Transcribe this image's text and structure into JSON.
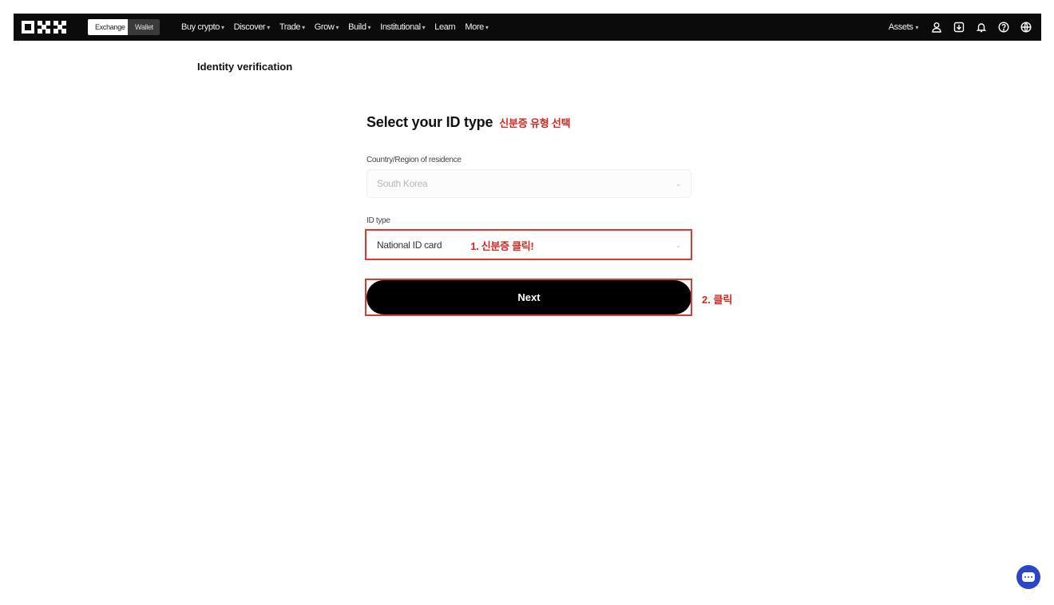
{
  "nav": {
    "mode_tabs": [
      {
        "label": "Exchange",
        "active": true
      },
      {
        "label": "Wallet",
        "active": false
      }
    ],
    "items": [
      {
        "label": "Buy crypto",
        "has_dropdown": true
      },
      {
        "label": "Discover",
        "has_dropdown": true
      },
      {
        "label": "Trade",
        "has_dropdown": true
      },
      {
        "label": "Grow",
        "has_dropdown": true
      },
      {
        "label": "Build",
        "has_dropdown": true
      },
      {
        "label": "Institutional",
        "has_dropdown": true
      },
      {
        "label": "Learn",
        "has_dropdown": false
      },
      {
        "label": "More",
        "has_dropdown": true
      }
    ],
    "assets_label": "Assets"
  },
  "page": {
    "title": "Identity verification"
  },
  "form": {
    "heading": "Select your ID type",
    "heading_annotation": "신분증 유형 선택",
    "country_label": "Country/Region of residence",
    "country_value": "South Korea",
    "id_type_label": "ID type",
    "id_type_value": "National ID card",
    "id_type_annotation": "1. 신분증 클릭!",
    "next_label": "Next",
    "next_annotation": "2. 클릭"
  },
  "colors": {
    "annotation_red": "#d1281f",
    "topbar_bg": "#0b0b0b",
    "chat_blue": "#2a45c9"
  }
}
